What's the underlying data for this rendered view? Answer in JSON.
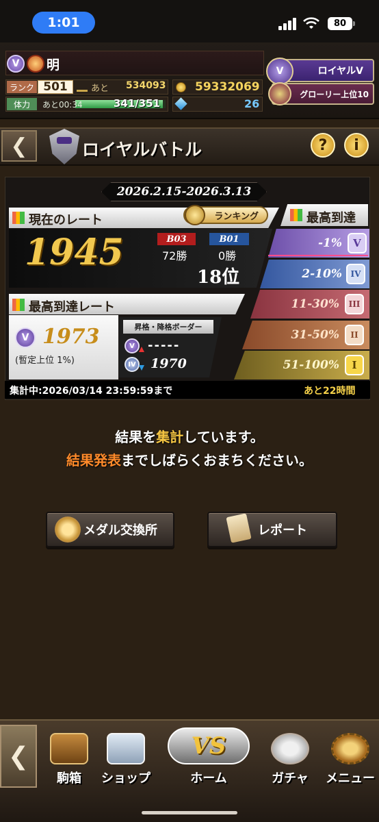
{
  "status_bar": {
    "time": "1:01",
    "battery": "80"
  },
  "player": {
    "vip_level": "V",
    "name": "明",
    "rank_label": "ランク",
    "rank": "501",
    "exp_label": "あと",
    "exp_to_next": "534093",
    "stamina_label": "体力",
    "stamina_timer": "あと00:34",
    "stamina": "341/351",
    "stamina_fraction": 0.97,
    "coins": "59332069",
    "gems": "26"
  },
  "header_buttons": {
    "royal": "ロイヤルV",
    "glory": "グローリー上位10"
  },
  "title": {
    "back": "❮",
    "text": "ロイヤルバトル",
    "help": "?",
    "info": "i"
  },
  "rating": {
    "period": "2026.2.15-2026.3.13",
    "current_label": "現在のレート",
    "ranking_button": "ランキング",
    "current_rate": "1945",
    "league_now": "B03",
    "league_top": "B01",
    "wins_now": "72勝",
    "wins_top": "0勝",
    "place": "18位",
    "best_label": "最高到達レート",
    "best_badge": "V",
    "best_rate": "1973",
    "best_note": "(暫定上位 1%)",
    "border_title": "昇格・降格ボーダー",
    "border_up_icon": "V",
    "border_up": "-----",
    "border_down_icon": "IV",
    "border_down": "1970",
    "peak_label": "最高到達",
    "tiers": [
      {
        "label": "-1%",
        "icon": "V",
        "color": "#6d4fa9"
      },
      {
        "label": "2-10%",
        "icon": "IV",
        "color": "#34579f"
      },
      {
        "label": "11-30%",
        "icon": "III",
        "color": "#8a3440"
      },
      {
        "label": "31-50%",
        "icon": "II",
        "color": "#8a4a2a"
      },
      {
        "label": "51-100%",
        "icon": "I",
        "color": "#6e5e1f"
      }
    ],
    "deadline": "集計中:2026/03/14 23:59:59まで",
    "remaining": "あと22時間"
  },
  "message": {
    "line1_pre": "結果を",
    "line1_hl": "集計",
    "line1_post": "しています。",
    "line2_hl": "結果発表",
    "line2_post": "までしばらくおまちください。"
  },
  "actions": {
    "medal_exchange": "メダル交換所",
    "report": "レポート"
  },
  "nav": {
    "back": "❮",
    "chest": "駒箱",
    "shop": "ショップ",
    "home_icon": "VS",
    "home": "ホーム",
    "gacha": "ガチャ",
    "menu": "メニュー"
  },
  "icons": [
    "signal-icon",
    "wifi-icon",
    "battery-icon",
    "vip-icon",
    "medal-icon",
    "coin-icon",
    "gem-icon",
    "royal-emblem-icon",
    "glory-emblem-icon",
    "royal-battle-emblem-icon",
    "help-icon",
    "info-icon",
    "ranking-icon",
    "chart-icon",
    "medal-exchange-icon",
    "report-scroll-icon",
    "chest-icon",
    "shop-icon",
    "vs-icon",
    "gacha-icon",
    "gear-icon"
  ]
}
